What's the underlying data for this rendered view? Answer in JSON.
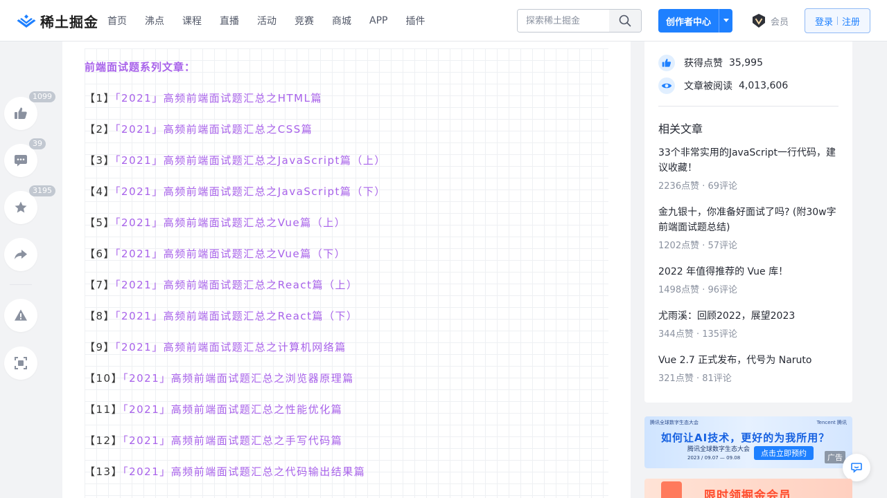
{
  "header": {
    "logo_text": "稀土掘金",
    "nav": [
      "首页",
      "沸点",
      "课程",
      "直播",
      "活动",
      "竞赛",
      "商城",
      "APP",
      "插件"
    ],
    "search_placeholder": "探索稀土掘金",
    "creator_label": "创作者中心",
    "vip_label": "会员",
    "login_label": "登录",
    "register_label": "注册"
  },
  "float_panel": {
    "like_count": "1099",
    "comment_count": "39",
    "collect_count": "3195"
  },
  "article": {
    "series_title": "前端面试题系列文章：",
    "items": [
      {
        "num": "【1】",
        "title": "「2021」高频前端面试题汇总之HTML篇"
      },
      {
        "num": "【2】",
        "title": "「2021」高频前端面试题汇总之CSS篇"
      },
      {
        "num": "【3】",
        "title": "「2021」高频前端面试题汇总之JavaScript篇（上）"
      },
      {
        "num": "【4】",
        "title": "「2021」高频前端面试题汇总之JavaScript篇（下）"
      },
      {
        "num": "【5】",
        "title": "「2021」高频前端面试题汇总之Vue篇（上）"
      },
      {
        "num": "【6】",
        "title": "「2021」高频前端面试题汇总之Vue篇（下）"
      },
      {
        "num": "【7】",
        "title": "「2021」高频前端面试题汇总之React篇（上）"
      },
      {
        "num": "【8】",
        "title": "「2021」高频前端面试题汇总之React篇（下）"
      },
      {
        "num": "【9】",
        "title": "「2021」高频前端面试题汇总之计算机网络篇"
      },
      {
        "num": "【10】",
        "title": "「2021」高频前端面试题汇总之浏览器原理篇"
      },
      {
        "num": "【11】",
        "title": "「2021」高频前端面试题汇总之性能优化篇"
      },
      {
        "num": "【12】",
        "title": "「2021」高频前端面试题汇总之手写代码篇"
      },
      {
        "num": "【13】",
        "title": "「2021」高频前端面试题汇总之代码输出结果篇"
      }
    ]
  },
  "sidebar": {
    "stats": [
      {
        "label": "获得点赞",
        "value": "35,995"
      },
      {
        "label": "文章被阅读",
        "value": "4,013,606"
      }
    ],
    "related_title": "相关文章",
    "related": [
      {
        "title": "33个非常实用的JavaScript一行代码，建议收藏！",
        "meta": "2236点赞 · 69评论"
      },
      {
        "title": "金九银十，你准备好面试了吗? (附30w字前端面试题总结)",
        "meta": "1202点赞 · 57评论"
      },
      {
        "title": "2022 年值得推荐的 Vue 库！",
        "meta": "1498点赞 · 96评论"
      },
      {
        "title": "尤雨溪：回顾2022，展望2023",
        "meta": "344点赞 · 135评论"
      },
      {
        "title": "Vue 2.7 正式发布，代号为 Naruto",
        "meta": "321点赞 · 81评论"
      }
    ]
  },
  "ads": {
    "ad1_headline": "如何让AI技术，更好的为我所用？",
    "ad1_sub": "腾讯全球数字生态大会",
    "ad1_cta": "点击立即预约",
    "ad1_date": "2023 / 09.07 — 09.08",
    "ad1_brand_left": "腾讯全球数字生态大会",
    "ad1_brand_right": "Tencent 腾讯",
    "ad_tag": "广告",
    "ad2_text": "限时领掘金会员"
  },
  "colors": {
    "accent": "#1e80ff",
    "link_purple": "#a862ea"
  }
}
